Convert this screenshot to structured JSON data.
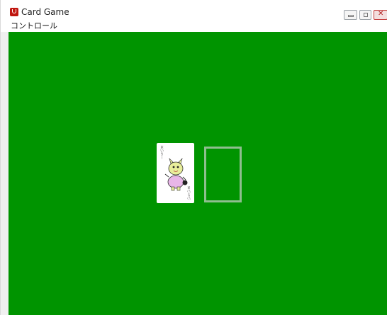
{
  "window": {
    "title": "Card Game",
    "icon": "app-icon",
    "controls": [
      "minimize-icon",
      "maximize-icon",
      "close-icon"
    ]
  },
  "menu": {
    "items": [
      {
        "label": "コントロール"
      }
    ]
  },
  "table": {
    "background": "#009400",
    "card": {
      "face_up": true,
      "label_top": "まいりー",
      "label_bottom": "いりいま",
      "art": "dragon-mascot"
    },
    "empty_slot": {
      "border_color": "#8fbe8f"
    }
  }
}
